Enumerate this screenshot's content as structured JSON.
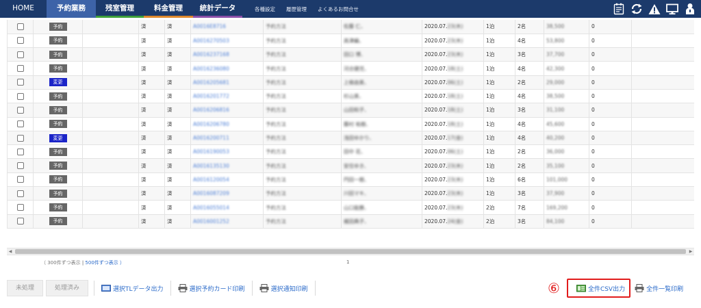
{
  "nav": {
    "tabs": [
      "HOME",
      "予約業務",
      "残室管理",
      "料金管理",
      "統計データ"
    ],
    "links": [
      "各種設定",
      "履歴管理",
      "よくあるお問合せ"
    ],
    "icons": [
      "report-icon",
      "refresh-icon",
      "alert-icon",
      "monitor-icon",
      "user-icon"
    ]
  },
  "table": {
    "rows": [
      {
        "badge": "予約",
        "c1": "済",
        "c2": "済",
        "id": "A0016E8716",
        "type": "予約方法",
        "name": "佐藤 仁、",
        "date_prefix": "2020.07.",
        "date_rest": "23(木)",
        "nights": "1泊",
        "guests": "2名",
        "price": "38,500",
        "point": "0"
      },
      {
        "badge": "予約",
        "c1": "済",
        "c2": "済",
        "id": "A0016270503",
        "type": "予約方法",
        "name": "高津編、",
        "date_prefix": "2020.07.",
        "date_rest": "23(木)",
        "nights": "1泊",
        "guests": "4名",
        "price": "53,800",
        "point": "0"
      },
      {
        "badge": "予約",
        "c1": "済",
        "c2": "済",
        "id": "A0016237168",
        "type": "予約方法",
        "name": "田口 博、",
        "date_prefix": "2020.07.",
        "date_rest": "23(木)",
        "nights": "1泊",
        "guests": "3名",
        "price": "37,700",
        "point": "0"
      },
      {
        "badge": "予約",
        "c1": "済",
        "c2": "済",
        "id": "A0016236080",
        "type": "予約方法",
        "name": "河合健児、",
        "date_prefix": "2020.07.",
        "date_rest": "18(土)",
        "nights": "1泊",
        "guests": "4名",
        "price": "42,300",
        "point": "0"
      },
      {
        "badge": "変更",
        "c1": "済",
        "c2": "済",
        "id": "A0016205681",
        "type": "予約方法",
        "name": "上條由美、",
        "date_prefix": "2020.07.",
        "date_rest": "06(土)",
        "nights": "1泊",
        "guests": "2名",
        "price": "29,000",
        "point": "0"
      },
      {
        "badge": "予約",
        "c1": "済",
        "c2": "済",
        "id": "A0016201772",
        "type": "予約方法",
        "name": "杉山美、",
        "date_prefix": "2020.07.",
        "date_rest": "18(土)",
        "nights": "1泊",
        "guests": "4名",
        "price": "38,500",
        "point": "0"
      },
      {
        "badge": "予約",
        "c1": "済",
        "c2": "済",
        "id": "A0016206816",
        "type": "予約方法",
        "name": "山田和子、",
        "date_prefix": "2020.07.",
        "date_rest": "18(土)",
        "nights": "1泊",
        "guests": "3名",
        "price": "31,100",
        "point": "0"
      },
      {
        "badge": "予約",
        "c1": "済",
        "c2": "済",
        "id": "A0016206780",
        "type": "予約方法",
        "name": "藤村 祐樹、",
        "date_prefix": "2020.07.",
        "date_rest": "18(土)",
        "nights": "1泊",
        "guests": "4名",
        "price": "45,600",
        "point": "0"
      },
      {
        "badge": "変更",
        "c1": "済",
        "c2": "済",
        "id": "A0016200711",
        "type": "予約方法",
        "name": "浅田ゆかり、",
        "date_prefix": "2020.07.",
        "date_rest": "17(金)",
        "nights": "1泊",
        "guests": "4名",
        "price": "40,200",
        "point": "0"
      },
      {
        "badge": "予約",
        "c1": "済",
        "c2": "済",
        "id": "A0016190053",
        "type": "予約方法",
        "name": "田中 花、",
        "date_prefix": "2020.07.",
        "date_rest": "06(土)",
        "nights": "1泊",
        "guests": "2名",
        "price": "36,000",
        "point": "0"
      },
      {
        "badge": "予約",
        "c1": "済",
        "c2": "済",
        "id": "A0016135130",
        "type": "予約方法",
        "name": "安住ゆき、",
        "date_prefix": "2020.07.",
        "date_rest": "23(木)",
        "nights": "1泊",
        "guests": "2名",
        "price": "35,100",
        "point": "0"
      },
      {
        "badge": "予約",
        "c1": "済",
        "c2": "済",
        "id": "A0016120054",
        "type": "予約方法",
        "name": "円田一樹、",
        "date_prefix": "2020.07.",
        "date_rest": "23(木)",
        "nights": "1泊",
        "guests": "6名",
        "price": "101,000",
        "point": "0"
      },
      {
        "badge": "予約",
        "c1": "済",
        "c2": "済",
        "id": "A0016087209",
        "type": "予約方法",
        "name": "川田マキ、",
        "date_prefix": "2020.07.",
        "date_rest": "23(木)",
        "nights": "1泊",
        "guests": "3名",
        "price": "37,900",
        "point": "0"
      },
      {
        "badge": "予約",
        "c1": "済",
        "c2": "済",
        "id": "A0016055014",
        "type": "予約方法",
        "name": "山口能勝、",
        "date_prefix": "2020.07.",
        "date_rest": "23(木)",
        "nights": "2泊",
        "guests": "7名",
        "price": "169,200",
        "point": "0"
      },
      {
        "badge": "予約",
        "c1": "済",
        "c2": "済",
        "id": "A0016001252",
        "type": "予約方法",
        "name": "梶田典子、",
        "date_prefix": "2020.07.",
        "date_rest": "24(金)",
        "nights": "2泊",
        "guests": "3名",
        "price": "84,100",
        "point": "0"
      }
    ]
  },
  "paging": {
    "label_300": "（ 300件ずつ表示",
    "separator": " | ",
    "label_500": "500件ずつ表示 ）",
    "page_number": "1"
  },
  "actions": {
    "unprocessed": "未処理",
    "processed": "処理済み",
    "selected_tl_output": "選択TLデータ出力",
    "selected_card_print": "選択予約カード印刷",
    "selected_notice_print": "選択通知印刷",
    "marker": "⑥",
    "csv_all_output": "全件CSV出力",
    "list_all_print": "全件一覧印刷"
  },
  "colors": {
    "nav_bg": "#1c3a6b",
    "active_tab": "#3d63a8",
    "highlight_red": "#e11b1b",
    "change_badge": "#1c25c8",
    "link_blue": "#2a6ac9"
  }
}
